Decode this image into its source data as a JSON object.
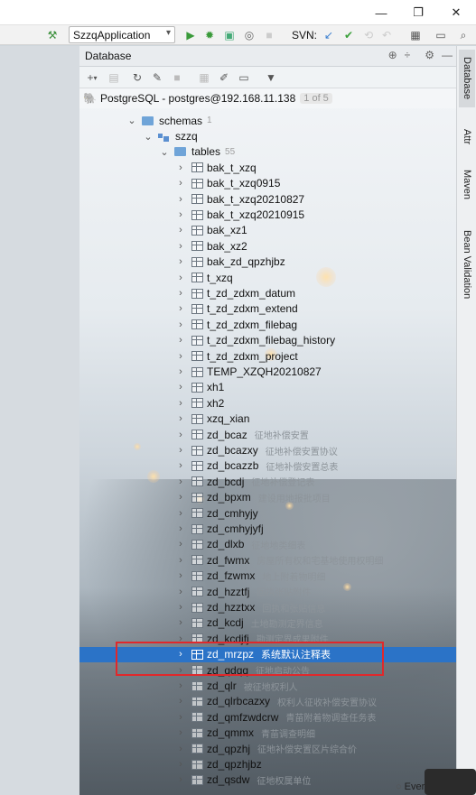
{
  "toolbar": {
    "run_config": "SzzqApplication",
    "svn_label": "SVN:"
  },
  "panel": {
    "title": "Database",
    "connection": "PostgreSQL - postgres@192.168.11.138",
    "connection_badge": "1 of 5"
  },
  "tree": {
    "schemas_label": "schemas",
    "schemas_count": "1",
    "schema_name": "szzq",
    "tables_label": "tables",
    "tables_count": "55",
    "tables": [
      {
        "name": "bak_t_xzq",
        "comment": ""
      },
      {
        "name": "bak_t_xzq0915",
        "comment": ""
      },
      {
        "name": "bak_t_xzq20210827",
        "comment": ""
      },
      {
        "name": "bak_t_xzq20210915",
        "comment": ""
      },
      {
        "name": "bak_xz1",
        "comment": ""
      },
      {
        "name": "bak_xz2",
        "comment": ""
      },
      {
        "name": "bak_zd_qpzhjbz",
        "comment": ""
      },
      {
        "name": "t_xzq",
        "comment": ""
      },
      {
        "name": "t_zd_zdxm_datum",
        "comment": ""
      },
      {
        "name": "t_zd_zdxm_extend",
        "comment": ""
      },
      {
        "name": "t_zd_zdxm_filebag",
        "comment": ""
      },
      {
        "name": "t_zd_zdxm_filebag_history",
        "comment": ""
      },
      {
        "name": "t_zd_zdxm_project",
        "comment": ""
      },
      {
        "name": "TEMP_XZQH20210827",
        "comment": ""
      },
      {
        "name": "xh1",
        "comment": ""
      },
      {
        "name": "xh2",
        "comment": ""
      },
      {
        "name": "xzq_xian",
        "comment": ""
      },
      {
        "name": "zd_bcaz",
        "comment": "征地补偿安置"
      },
      {
        "name": "zd_bcazxy",
        "comment": "征地补偿安置协议"
      },
      {
        "name": "zd_bcazzb",
        "comment": "征地补偿安置总表"
      },
      {
        "name": "zd_bcdj",
        "comment": "征地补偿登记表"
      },
      {
        "name": "zd_bpxm",
        "comment": "建设用地报批项目"
      },
      {
        "name": "zd_cmhyjy",
        "comment": ""
      },
      {
        "name": "zd_cmhyjyfj",
        "comment": ""
      },
      {
        "name": "zd_dlxb",
        "comment": "征地地类细表"
      },
      {
        "name": "zd_fwmx",
        "comment": "房屋所有权和宅基地使用权明细"
      },
      {
        "name": "zd_fzwmx",
        "comment": "地上附着物明细"
      },
      {
        "name": "zd_hzztfj",
        "comment": "回执张贴附件"
      },
      {
        "name": "zd_hzztxx",
        "comment": "回执和张贴信息"
      },
      {
        "name": "zd_kcdj",
        "comment": "土地勘测定界信息"
      },
      {
        "name": "zd_kcdjfj",
        "comment": "勘测定界成果附件"
      },
      {
        "name": "zd_mrzpz",
        "comment": "系统默认注释表"
      },
      {
        "name": "zd_qdqq",
        "comment": "征地启动公告"
      },
      {
        "name": "zd_qlr",
        "comment": "被征地权利人"
      },
      {
        "name": "zd_qlrbcazxy",
        "comment": "权利人征收补偿安置协议"
      },
      {
        "name": "zd_qmfzwdcrw",
        "comment": "青苗附着物调查任务表"
      },
      {
        "name": "zd_qmmx",
        "comment": "青苗调查明细"
      },
      {
        "name": "zd_qpzhj",
        "comment": "征地补偿安置区片综合价"
      },
      {
        "name": "zd_qpzhjbz",
        "comment": ""
      },
      {
        "name": "zd_qsdw",
        "comment": "征地权属单位"
      }
    ]
  },
  "right_tabs": [
    "Database",
    "Attr",
    "Maven",
    "Bean Validation"
  ],
  "bottom_text": "Ever"
}
